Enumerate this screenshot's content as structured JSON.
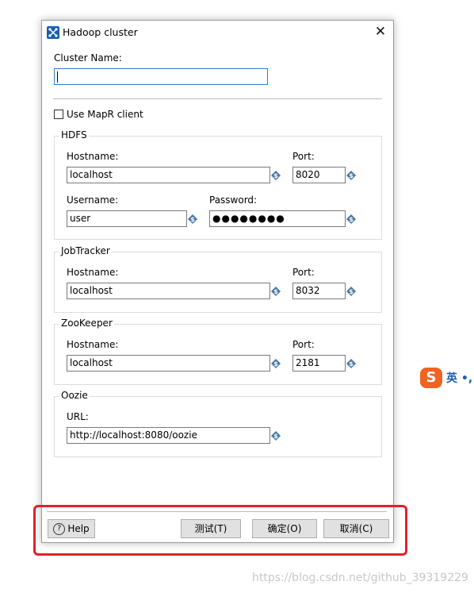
{
  "window": {
    "title": "Hadoop cluster",
    "close_glyph": "✕",
    "app_icon": "hadoop-cluster-icon"
  },
  "cluster": {
    "name_label": "Cluster Name:",
    "name_value": ""
  },
  "mapr": {
    "label": "Use MapR client",
    "checked": false
  },
  "hdfs": {
    "title": "HDFS",
    "hostname_label": "Hostname:",
    "hostname": "localhost",
    "port_label": "Port:",
    "port": "8020",
    "username_label": "Username:",
    "username": "user",
    "password_label": "Password:",
    "password": "●●●●●●●●"
  },
  "jobtracker": {
    "title": "JobTracker",
    "hostname_label": "Hostname:",
    "hostname": "localhost",
    "port_label": "Port:",
    "port": "8032"
  },
  "zookeeper": {
    "title": "ZooKeeper",
    "hostname_label": "Hostname:",
    "hostname": "localhost",
    "port_label": "Port:",
    "port": "2181"
  },
  "oozie": {
    "title": "Oozie",
    "url_label": "URL:",
    "url": "http://localhost:8080/oozie"
  },
  "buttons": {
    "help": "Help",
    "help_glyph": "?",
    "test": "测试(T)",
    "ok": "确定(O)",
    "cancel": "取消(C)"
  },
  "ime": {
    "logo": "S",
    "text": "英 •,"
  },
  "watermark": "https://blog.csdn.net/github_39319229",
  "colors": {
    "highlight_border": "#e4202c",
    "focus_border": "#2b7fc8",
    "variable_icon": "#4a7aa8"
  }
}
